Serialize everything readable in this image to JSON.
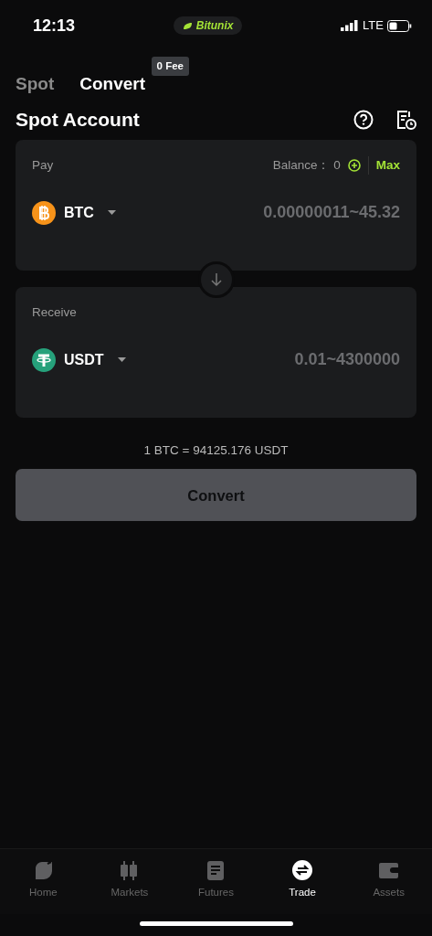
{
  "status_bar": {
    "time": "12:13",
    "app_pill": "Bitunix",
    "network": "LTE"
  },
  "tabs": [
    {
      "label": "Spot",
      "selected": false
    },
    {
      "label": "Convert",
      "selected": true,
      "badge": "0 Fee"
    }
  ],
  "heading": "Spot Account",
  "pay": {
    "label": "Pay",
    "balance_label": "Balance：",
    "balance": "0",
    "max": "Max",
    "coin": "BTC",
    "kind": "btc",
    "range": "0.00000011~45.32"
  },
  "receive": {
    "label": "Receive",
    "coin": "USDT",
    "kind": "usdt",
    "range": "0.01~4300000"
  },
  "rate": "1 BTC = 94125.176 USDT",
  "convert_button": {
    "label": "Convert",
    "disabled": true
  },
  "nav": [
    {
      "label": "Home",
      "kind": "home",
      "selected": false
    },
    {
      "label": "Markets",
      "kind": "markets",
      "selected": false
    },
    {
      "label": "Futures",
      "kind": "futures",
      "selected": false
    },
    {
      "label": "Trade",
      "kind": "trade",
      "selected": true
    },
    {
      "label": "Assets",
      "kind": "assets",
      "selected": false
    }
  ]
}
